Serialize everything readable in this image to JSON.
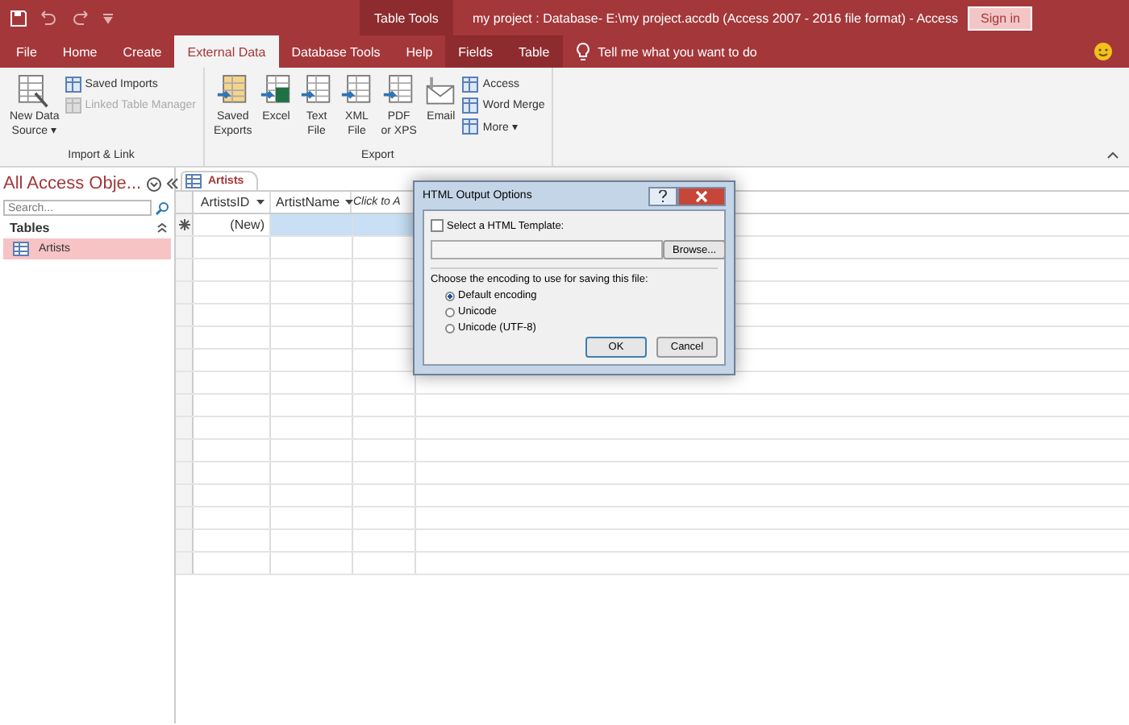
{
  "window": {
    "title": "my project : Database- E:\\my project.accdb (Access 2007 - 2016 file format)  -  Access",
    "context_title": "Table Tools",
    "sign_in": "Sign in"
  },
  "tabs": [
    {
      "label": "File",
      "selected": false,
      "context": false
    },
    {
      "label": "Home",
      "selected": false,
      "context": false
    },
    {
      "label": "Create",
      "selected": false,
      "context": false
    },
    {
      "label": "External Data",
      "selected": true,
      "context": false
    },
    {
      "label": "Database Tools",
      "selected": false,
      "context": false
    },
    {
      "label": "Help",
      "selected": false,
      "context": false
    },
    {
      "label": "Fields",
      "selected": false,
      "context": true
    },
    {
      "label": "Table",
      "selected": false,
      "context": true
    }
  ],
  "tell_me": "Tell me what you want to do",
  "ribbon": [
    {
      "label": "Import & Link",
      "large": [
        {
          "lines": [
            "New Data",
            "Source ▾"
          ],
          "kind": "new"
        }
      ],
      "small": [
        {
          "label": "Saved Imports",
          "disabled": false
        },
        {
          "label": "Linked Table Manager",
          "disabled": true
        }
      ]
    },
    {
      "label": "Export",
      "large": [
        {
          "lines": [
            "Saved",
            "Exports"
          ],
          "kind": "saved"
        },
        {
          "lines": [
            "Excel"
          ],
          "kind": "excel"
        },
        {
          "lines": [
            "Text",
            "File"
          ],
          "kind": "text"
        },
        {
          "lines": [
            "XML",
            "File"
          ],
          "kind": "xml"
        },
        {
          "lines": [
            "PDF",
            "or XPS"
          ],
          "kind": "pdf"
        },
        {
          "lines": [
            "Email"
          ],
          "kind": "email"
        }
      ],
      "small": [
        {
          "label": "Access",
          "disabled": false
        },
        {
          "label": "Word Merge",
          "disabled": false
        },
        {
          "label": "More ▾",
          "disabled": false
        }
      ]
    }
  ],
  "nav": {
    "title": "All Access Obje...",
    "search": {
      "placeholder": "Search..."
    },
    "section": "Tables",
    "items": [
      {
        "label": "Artists",
        "selected": true
      }
    ]
  },
  "document_tab": "Artists",
  "table": {
    "columns": [
      "ArtistsID",
      "ArtistName",
      "Click to A"
    ],
    "new_row": "(New)"
  },
  "dialog": {
    "title": "HTML Output Options",
    "template_label": "Select a HTML Template:",
    "template_checked": false,
    "browse": "Browse...",
    "encoding_label": "Choose the encoding to use for saving this file:",
    "options": [
      {
        "label": "Default encoding",
        "selected": true
      },
      {
        "label": "Unicode",
        "selected": false
      },
      {
        "label": "Unicode (UTF-8)",
        "selected": false
      }
    ],
    "buttons": [
      "OK",
      "Cancel"
    ]
  }
}
